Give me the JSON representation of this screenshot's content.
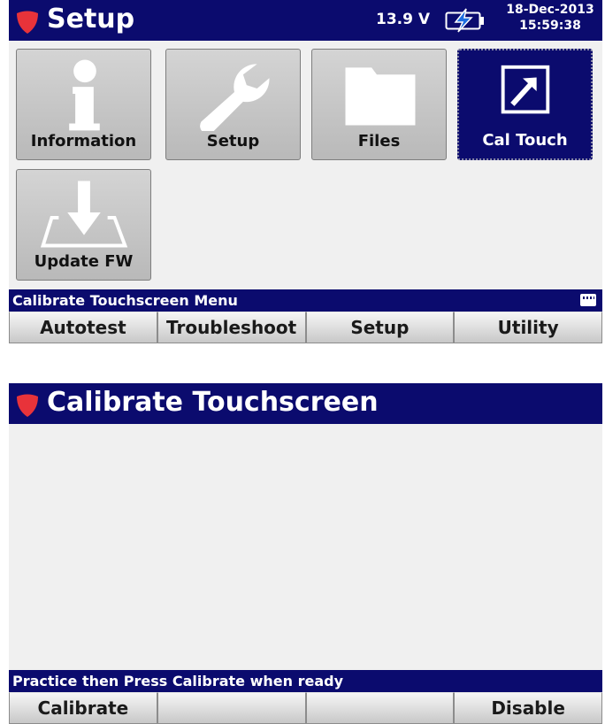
{
  "screen1": {
    "header": {
      "title": "Setup",
      "voltage": "13.9 V",
      "date": "18-Dec-2013",
      "time": "15:59:38"
    },
    "tiles": [
      {
        "label": "Information",
        "icon": "info-icon",
        "selected": false
      },
      {
        "label": "Setup",
        "icon": "wrench-icon",
        "selected": false
      },
      {
        "label": "Files",
        "icon": "folder-icon",
        "selected": false
      },
      {
        "label": "Cal Touch",
        "icon": "calibrate-arrow-icon",
        "selected": true
      },
      {
        "label": "Update FW",
        "icon": "download-icon",
        "selected": false
      }
    ],
    "menu_title": "Calibrate Touchscreen Menu",
    "softkeys": [
      "Autotest",
      "Troubleshoot",
      "Setup",
      "Utility"
    ]
  },
  "screen2": {
    "header": {
      "title": "Calibrate Touchscreen"
    },
    "status": "Practice then Press Calibrate when ready",
    "softkeys": [
      "Calibrate",
      "",
      "",
      "Disable"
    ]
  },
  "colors": {
    "titlebar": "#0b0b6e",
    "shield": "#e8333a",
    "battery_bolt": "#1f6fe0",
    "panel": "#f0f0f0"
  }
}
